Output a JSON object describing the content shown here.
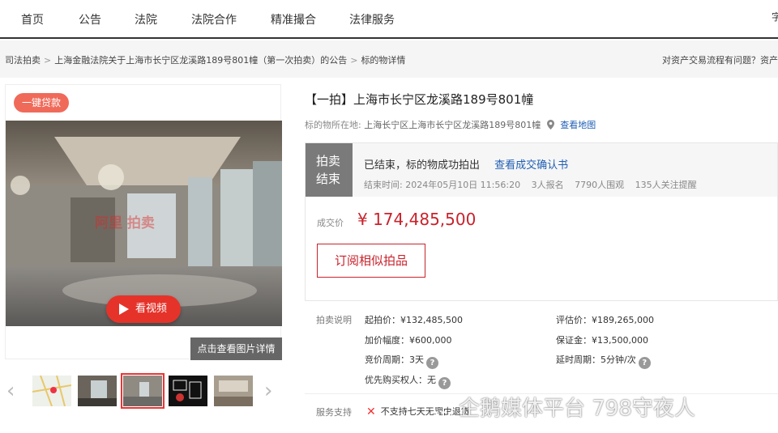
{
  "nav": {
    "items": [
      "首页",
      "公告",
      "法院",
      "法院合作",
      "精准撮合",
      "法律服务"
    ],
    "edge_glyph": "字"
  },
  "breadcrumb": {
    "items": [
      "司法拍卖",
      "上海金融法院关于上海市长宁区龙溪路189号801幢（第一次拍卖）的公告",
      "标的物详情"
    ],
    "right_text": "对资产交易流程有问题？资产"
  },
  "gallery": {
    "loan_badge": "一键贷款",
    "photo_watermark": "阿里 拍卖",
    "video_label": "看视频",
    "more_pics_label": "点击查看图片详情",
    "thumbs": [
      "map-thumb",
      "room-thumb",
      "hall-thumb",
      "floorplan-thumb",
      "interior-thumb"
    ],
    "active_thumb_index": 2,
    "prev_arrow": "‹",
    "next_arrow": "›"
  },
  "lot": {
    "title": "【一拍】上海市长宁区龙溪路189号801幢",
    "location_label": "标的物所在地:",
    "location_value": "上海长宁区上海市长宁区龙溪路189号801幢",
    "map_link": "查看地图"
  },
  "status": {
    "box_line1": "拍卖",
    "box_line2": "结束",
    "result": "已结束，标的物成功拍出",
    "confirm_link": "查看成交确认书",
    "end_time": "结束时间:  2024年05月10日 11:56:20",
    "signups": "3人报名",
    "viewers": "7790人围观",
    "followers": "135人关注提醒",
    "price_label": "成交价",
    "price_value": "¥ 174,485,500",
    "subscribe_label": "订阅相似拍品"
  },
  "details": {
    "section_label": "拍卖说明",
    "start_price": "起拍价：¥132,485,500",
    "appraisal": "评估价：¥189,265,000",
    "increment": "加价幅度：¥600,000",
    "deposit": "保证金：¥13,500,000",
    "bid_period": "竞价周期：3天",
    "extension": "延时周期：5分钟/次",
    "priority_buyer": "优先购买权人：无",
    "help_glyph": "?"
  },
  "service": {
    "section_label": "服务支持",
    "no_return": "不支持七天无理由退货"
  },
  "overlay": {
    "watermark": "企鹅媒体平台 798守夜人"
  }
}
